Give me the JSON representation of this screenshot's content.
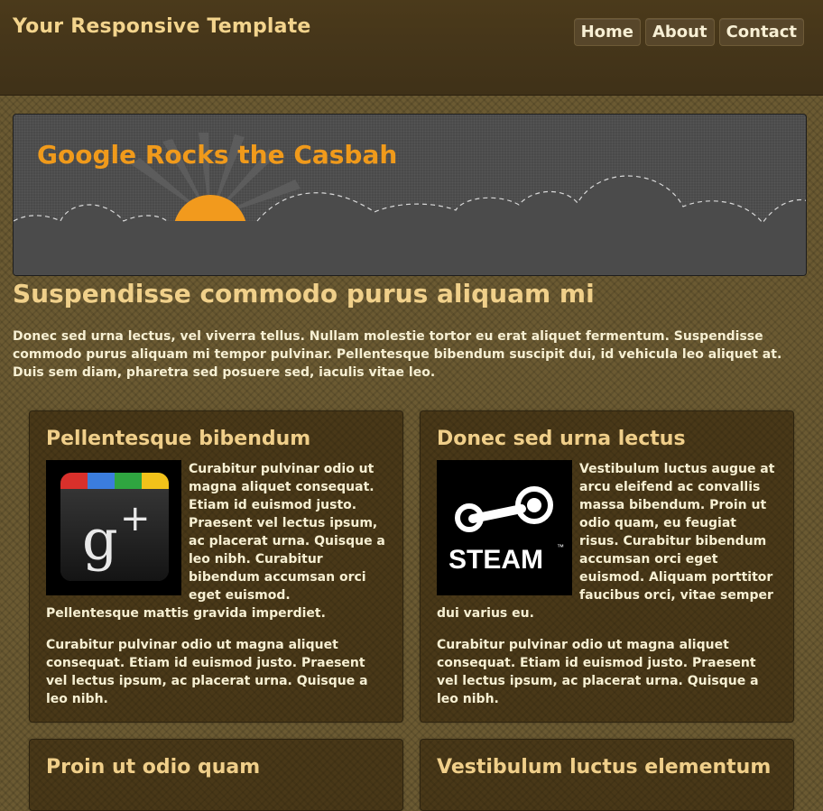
{
  "header": {
    "site_title": "Your Responsive Template",
    "nav": [
      {
        "label": "Home"
      },
      {
        "label": "About"
      },
      {
        "label": "Contact"
      }
    ]
  },
  "banner": {
    "title": "Google Rocks the Casbah"
  },
  "main": {
    "headline": "Suspendisse commodo purus aliquam mi",
    "intro": "Donec sed urna lectus, vel viverra tellus. Nullam molestie tortor eu erat aliquet fermentum. Suspendisse commodo purus aliquam mi tempor pulvinar. Pellentesque bibendum suscipit dui, id vehicula leo aliquet at. Duis sem diam, pharetra sed posuere sed, iaculis vitae leo."
  },
  "cards": [
    {
      "title": "Pellentesque bibendum",
      "image": "google-plus-icon",
      "p1": "Curabitur pulvinar odio ut magna aliquet consequat. Etiam id euismod justo. Praesent vel lectus ipsum, ac placerat urna. Quisque a leo nibh. Curabitur bibendum accumsan orci eget euismod. Pellentesque mattis gravida imperdiet.",
      "p2": "Curabitur pulvinar odio ut magna aliquet consequat. Etiam id euismod justo. Praesent vel lectus ipsum, ac placerat urna. Quisque a leo nibh."
    },
    {
      "title": "Donec sed urna lectus",
      "image": "steam-logo-icon",
      "logo_text": "STEAM",
      "p1": "Vestibulum luctus augue at arcu eleifend ac convallis massa bibendum. Proin ut odio quam, eu feugiat risus. Curabitur bibendum accumsan orci eget euismod. Aliquam porttitor faucibus orci, vitae semper dui varius eu.",
      "p2": "Curabitur pulvinar odio ut magna aliquet consequat. Etiam id euismod justo. Praesent vel lectus ipsum, ac placerat urna. Quisque a leo nibh."
    },
    {
      "title": "Proin ut odio quam"
    },
    {
      "title": "Vestibulum luctus elementum"
    }
  ],
  "colors": {
    "accent_orange": "#f09a1b",
    "heading_tan": "#f0d08a",
    "header_bg": "#4b3a1b"
  }
}
